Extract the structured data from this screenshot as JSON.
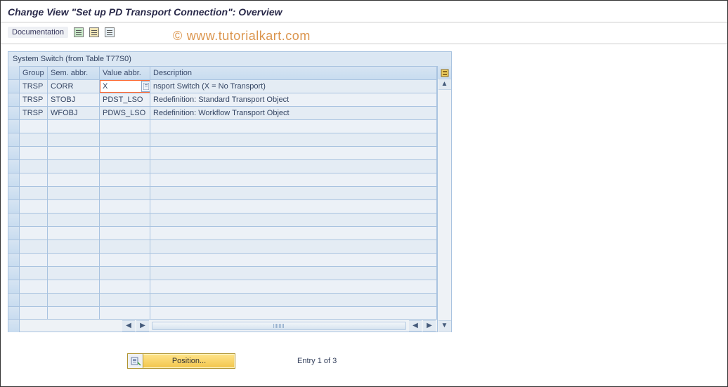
{
  "title": "Change View \"Set up PD Transport Connection\": Overview",
  "toolbar": {
    "documentation_label": "Documentation"
  },
  "watermark": {
    "symbol": "©",
    "text": "www.tutorialkart.com"
  },
  "panel": {
    "title": "System Switch (from Table T77S0)"
  },
  "columns": {
    "group": "Group",
    "sem_abbr": "Sem. abbr.",
    "value_abbr": "Value abbr.",
    "description": "Description"
  },
  "rows": [
    {
      "group": "TRSP",
      "sem": "CORR",
      "val": "X",
      "desc": "Transport Switch (X = No Transport)",
      "desc_visible": "nsport Switch (X = No Transport)"
    },
    {
      "group": "TRSP",
      "sem": "STOBJ",
      "val": "PDST_LSO",
      "desc": "Redefinition: Standard Transport Object",
      "desc_visible": "Redefinition: Standard Transport Object"
    },
    {
      "group": "TRSP",
      "sem": "WFOBJ",
      "val": "PDWS_LSO",
      "desc": "Redefinition: Workflow Transport Object",
      "desc_visible": "Redefinition: Workflow Transport Object"
    }
  ],
  "empty_rows": 15,
  "footer": {
    "position_label": "Position...",
    "entry_text": "Entry 1 of 3"
  }
}
